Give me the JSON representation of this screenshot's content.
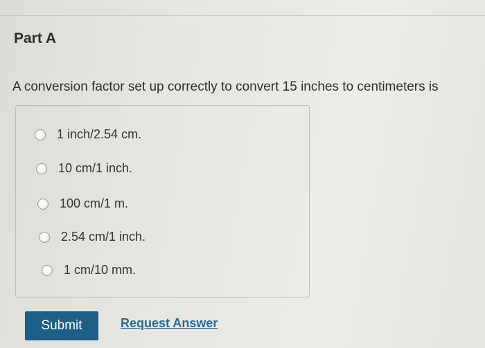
{
  "part": {
    "title": "Part A"
  },
  "question": {
    "text": "A conversion factor set up correctly to convert 15 inches to centimeters is"
  },
  "options": [
    {
      "label": "1 inch/2.54 cm."
    },
    {
      "label": "10 cm/1 inch."
    },
    {
      "label": "100 cm/1 m."
    },
    {
      "label": "2.54 cm/1 inch."
    },
    {
      "label": "1 cm/10 mm."
    }
  ],
  "actions": {
    "submit_label": "Submit",
    "request_answer_label": "Request Answer"
  },
  "colors": {
    "submit_background": "#1d5f86",
    "link": "#2a6a96"
  }
}
